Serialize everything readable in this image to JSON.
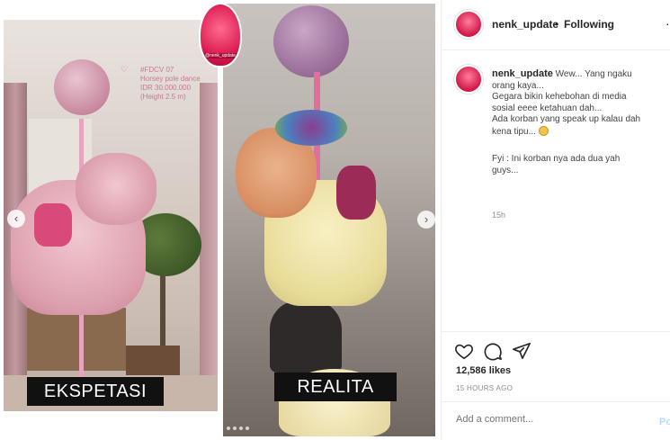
{
  "post": {
    "left_label": "EKSPETASI",
    "right_label": "REALITA",
    "overlay_lines": [
      "#FDCV 07",
      "Horsey pole dance",
      "IDR 30.000.000",
      "(Height 2.5 m)"
    ],
    "watermark": "@nenk_update"
  },
  "panel": {
    "username": "nenk_update",
    "separator": "•",
    "following": "Following",
    "more_icon": "more-icon",
    "caption_user": "nenk_update",
    "caption_lines": [
      "Wew... Yang ngaku",
      "orang kaya...",
      "Gegara bikin kehebohan di media",
      "sosial eeee ketahuan dah...",
      "Ada korban yang speak up kalau dah",
      "kena tipu..."
    ],
    "caption_second_lines": [
      "Fyi : Ini korban nya ada dua yah",
      "guys..."
    ],
    "comment_age": "15h",
    "likes": "12,586 likes",
    "posted_ago": "15 HOURS AGO",
    "comment_placeholder": "Add a comment...",
    "post_button": "Po"
  },
  "colors": {
    "accent_pink": "#d6124a",
    "post_button": "#b3dbff",
    "muted": "#8e8e8e"
  }
}
